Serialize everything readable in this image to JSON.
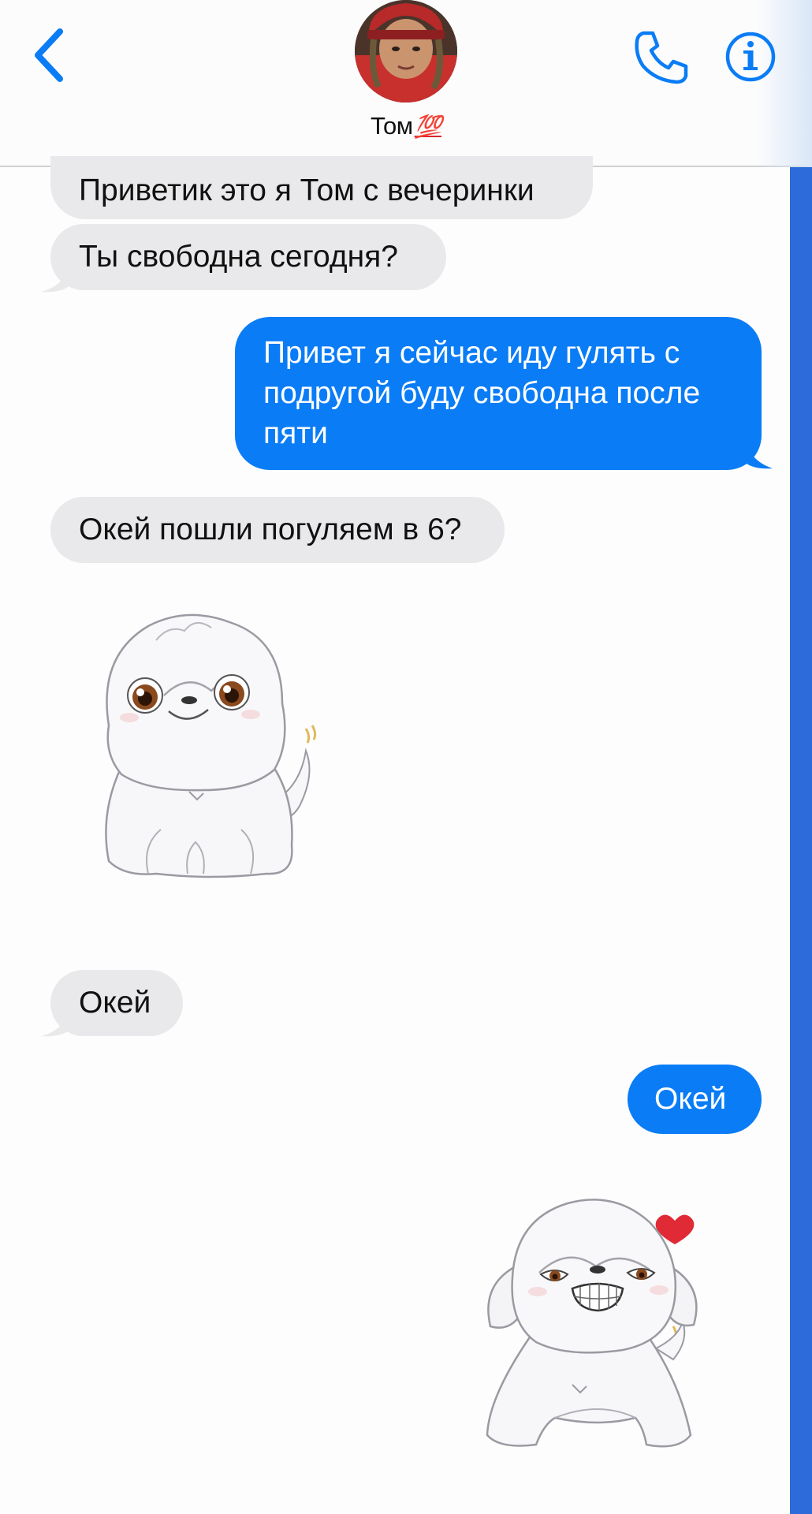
{
  "header": {
    "contact_name": "Том",
    "contact_emoji": "💯",
    "back_icon": "chevron-left-icon",
    "call_icon": "phone-icon",
    "info_icon": "info-icon",
    "accent_color": "#0a7cf6"
  },
  "messages": [
    {
      "direction": "incoming",
      "text": "Приветик это я Том с вечеринки"
    },
    {
      "direction": "incoming",
      "text": "Ты свободна сегодня?"
    },
    {
      "direction": "outgoing",
      "lines": [
        "Привет я сейчас иду гулять с",
        "подругой буду свободна после",
        "пяти"
      ]
    },
    {
      "direction": "incoming",
      "text": "Окей пошли погуляем в 6?"
    },
    {
      "direction": "incoming",
      "sticker": "white-dog-sticker-icon"
    },
    {
      "direction": "incoming",
      "text": "Окей"
    },
    {
      "direction": "outgoing",
      "text": "Окей"
    },
    {
      "direction": "outgoing",
      "sticker": "grinning-dog-heart-sticker-icon"
    }
  ],
  "colors": {
    "incoming_bubble": "#e9e9eb",
    "outgoing_bubble": "#0a7cf6",
    "side_strip": "#2e6bda"
  }
}
